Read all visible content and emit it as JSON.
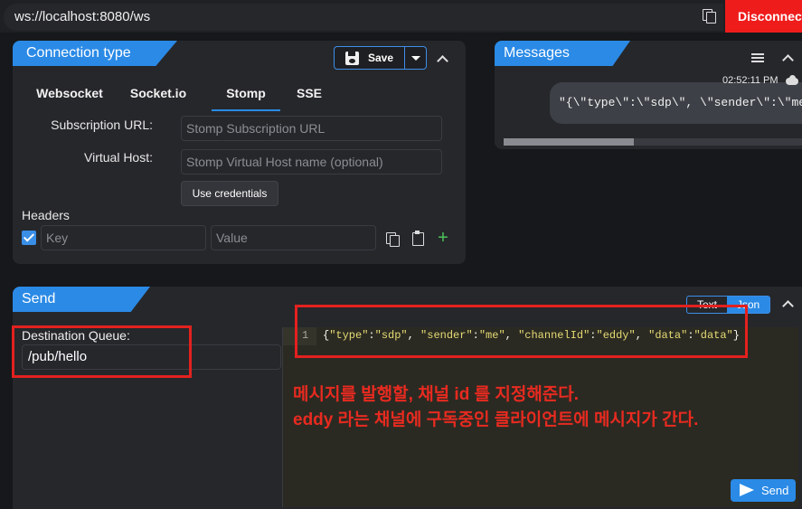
{
  "urlbar": {
    "url": "ws://localhost:8080/ws",
    "disconnect_label": "Disconnect"
  },
  "connection": {
    "title": "Connection type",
    "save_label": "Save",
    "tabs": [
      {
        "label": "Websocket",
        "active": false
      },
      {
        "label": "Socket.io",
        "active": false
      },
      {
        "label": "Stomp",
        "active": true
      },
      {
        "label": "SSE",
        "active": false
      }
    ],
    "subscription_label": "Subscription URL:",
    "subscription_placeholder": "Stomp Subscription URL",
    "vhost_label": "Virtual Host:",
    "vhost_placeholder": "Stomp Virtual Host name (optional)",
    "credentials_label": "Use credentials",
    "headers_label": "Headers",
    "key_placeholder": "Key",
    "value_placeholder": "Value"
  },
  "messages": {
    "title": "Messages",
    "time": "02:52:11 PM",
    "message_text": "\"{\\\"type\\\":\\\"sdp\\\", \\\"sender\\\":\\\"me\\\"}\""
  },
  "send": {
    "title": "Send",
    "mode_text": "Text",
    "mode_json": "Json",
    "destination_label": "Destination Queue:",
    "destination_value": "/pub/hello",
    "line_number": "1",
    "code": {
      "open": "{",
      "k1": "\"type\"",
      "v1": "\"sdp\"",
      "k2": "\"sender\"",
      "v2": "\"me\"",
      "k3": "\"channelId\"",
      "v3": "\"eddy\"",
      "k4": "\"data\"",
      "v4": "\"data\"",
      "close": "}"
    },
    "send_label": "Send"
  },
  "annotation": {
    "line1": "메시지를 발행할, 채널 id 를 지정해준다.",
    "line2": "eddy 라는 채널에 구독중인 클라이언트에 메시지가 간다."
  },
  "colors": {
    "accent": "#2a8ae6",
    "disconnect": "#ef1c1c",
    "annotation": "#e3211f"
  }
}
